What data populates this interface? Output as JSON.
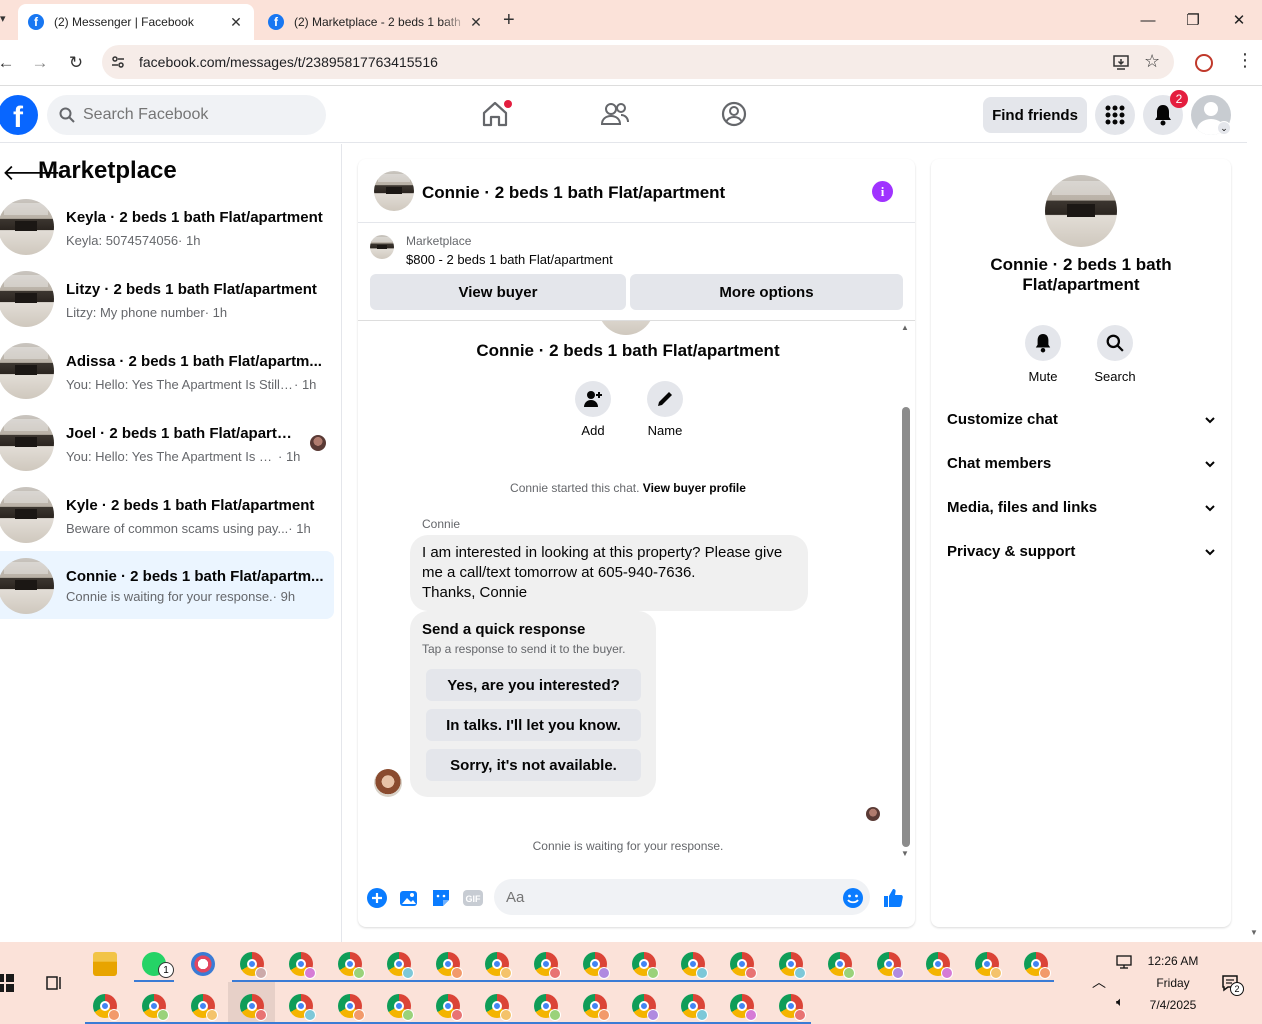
{
  "browser": {
    "tabs": [
      {
        "title": "(2) Messenger | Facebook",
        "active": true
      },
      {
        "title": "(2) Marketplace - 2 beds 1 bath",
        "active": false
      }
    ],
    "url": "facebook.com/messages/t/23895817763415516"
  },
  "header": {
    "search_placeholder": "Search Facebook",
    "find_friends": "Find friends",
    "notification_count": "2",
    "brand_color": "#0866ff"
  },
  "sidebar": {
    "title": "Marketplace",
    "chats": [
      {
        "name": "Keyla · 2 beds 1 bath Flat/apartment",
        "preview": "Keyla: 5074574056",
        "time": "· 1h",
        "selected": false
      },
      {
        "name": "Litzy · 2 beds 1 bath Flat/apartment",
        "preview": "Litzy: My phone number",
        "time": "· 1h",
        "selected": false
      },
      {
        "name": "Adissa · 2 beds 1 bath Flat/apartm...",
        "preview": "You: Hello: Yes The Apartment Is Still ...",
        "time": "· 1h",
        "selected": false
      },
      {
        "name": "Joel · 2 beds 1 bath Flat/apartm...",
        "preview": "You: Hello: Yes The Apartment Is Sti...",
        "time": "· 1h",
        "selected": false
      },
      {
        "name": "Kyle · 2 beds 1 bath Flat/apartment",
        "preview": "Beware of common scams using pay...",
        "time": "· 1h",
        "selected": false
      },
      {
        "name": "Connie · 2 beds 1 bath Flat/apartm...",
        "preview": "Connie is waiting for your response.",
        "time": "· 9h",
        "selected": true
      }
    ]
  },
  "chat": {
    "title": "Connie · 2 beds 1 bath Flat/apartment",
    "marketplace_label": "Marketplace",
    "listing": "$800 - 2 beds 1 bath Flat/apartment",
    "view_buyer": "View buyer",
    "more_options": "More options",
    "center_name": "Connie · 2 beds 1 bath Flat/apartment",
    "add_label": "Add",
    "name_label": "Name",
    "started_text": "Connie started this chat.",
    "view_profile": "View buyer profile",
    "sender": "Connie",
    "message": "I am interested in looking at this property?  Please give me a call/text tomorrow at 605-940-7636.\nThanks, Connie",
    "quick_title": "Send a quick response",
    "quick_sub": "Tap a response to send it to the buyer.",
    "quick_responses": [
      "Yes, are you interested?",
      "In talks. I'll let you know.",
      "Sorry, it's not available."
    ],
    "waiting": "Connie is waiting for your response.",
    "input_placeholder": "Aa",
    "accent_color": "#0a7cff"
  },
  "details": {
    "name": "Connie · 2 beds 1 bath Flat/apartment",
    "mute": "Mute",
    "search": "Search",
    "sections": [
      "Customize chat",
      "Chat members",
      "Media, files and links",
      "Privacy & support"
    ]
  },
  "taskbar": {
    "time": "12:26 AM",
    "day": "Friday",
    "date": "7/4/2025",
    "whatsapp_badge": "1",
    "notif_badge": "2"
  }
}
